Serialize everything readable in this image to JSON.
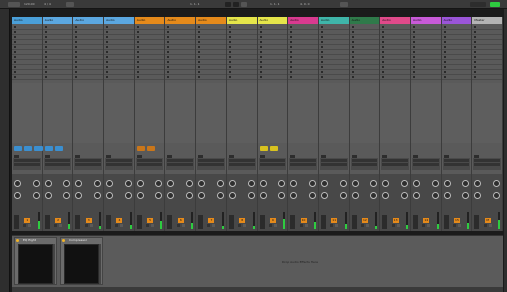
{
  "window": {
    "title": "Live Session View"
  },
  "transport": {
    "tempo": "120.00",
    "signature": "4 / 4",
    "position": "1. 1. 1",
    "loop_start": "1. 1. 1",
    "loop_length": "4. 0. 0"
  },
  "tracks": [
    {
      "name": "Audio",
      "color": "#4a9fd8",
      "clip_color": "#3b8fd0",
      "clip_count": 3,
      "number": "1",
      "meter": 0.45
    },
    {
      "name": "Audio",
      "color": "#5ba7e0",
      "clip_color": "#3b8fd0",
      "clip_count": 2,
      "number": "2",
      "meter": 0.3
    },
    {
      "name": "Audio",
      "color": "#5ba7e0",
      "clip_color": "#3b8fd0",
      "clip_count": 0,
      "number": "3",
      "meter": 0.2
    },
    {
      "name": "Audio",
      "color": "#5ba7e0",
      "clip_color": "#3b8fd0",
      "clip_count": 0,
      "number": "4",
      "meter": 0.25
    },
    {
      "name": "Audio",
      "color": "#e58a1b",
      "clip_color": "#c9761a",
      "clip_count": 2,
      "number": "5",
      "meter": 0.5
    },
    {
      "name": "Audio",
      "color": "#e58a1b",
      "clip_color": "#c9761a",
      "clip_count": 0,
      "number": "6",
      "meter": 0.35
    },
    {
      "name": "Audio",
      "color": "#e58a1b",
      "clip_color": "#c9761a",
      "clip_count": 0,
      "number": "7",
      "meter": 0.2
    },
    {
      "name": "Audio",
      "color": "#e5e54a",
      "clip_color": "#d8c21f",
      "clip_count": 0,
      "number": "8",
      "meter": 0.15
    },
    {
      "name": "Audio",
      "color": "#e5e54a",
      "clip_color": "#d8c21f",
      "clip_count": 2,
      "number": "9",
      "meter": 0.6
    },
    {
      "name": "Audio",
      "color": "#d83a8f",
      "clip_color": "#c62d7e",
      "clip_count": 0,
      "number": "10",
      "meter": 0.4
    },
    {
      "name": "Audio",
      "color": "#3fb5a9",
      "clip_color": "#2f9a8f",
      "clip_count": 0,
      "number": "11",
      "meter": 0.3
    },
    {
      "name": "Audio",
      "color": "#2f7a4a",
      "clip_color": "#2f7a4a",
      "clip_count": 0,
      "number": "12",
      "meter": 0.2
    },
    {
      "name": "Audio",
      "color": "#e04a8a",
      "clip_color": "#c62d7e",
      "clip_count": 0,
      "number": "13",
      "meter": 0.25
    },
    {
      "name": "Audio",
      "color": "#c85ad8",
      "clip_color": "#a94ab8",
      "clip_count": 0,
      "number": "14",
      "meter": 0.3
    },
    {
      "name": "Audio",
      "color": "#9a55d8",
      "clip_color": "#8a45c8",
      "clip_count": 0,
      "number": "15",
      "meter": 0.35
    },
    {
      "name": "Master",
      "color": "#b4b4b4",
      "clip_color": "#999999",
      "clip_count": 0,
      "number": "M",
      "meter": 0.55
    }
  ],
  "detail": {
    "devices": [
      {
        "name": "EQ Eight"
      },
      {
        "name": "Compressor"
      }
    ],
    "drop_hint": "Drop Audio Effects Here"
  }
}
